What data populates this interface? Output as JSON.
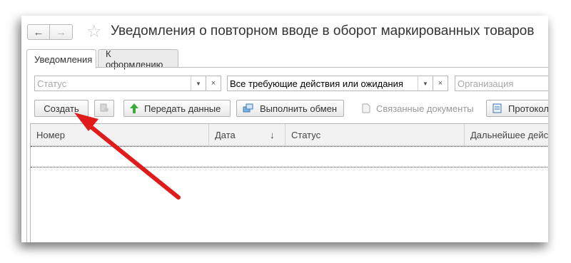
{
  "window": {
    "title": "Уведомления о повторном вводе в оборот маркированных товаров",
    "back_icon": "←",
    "forward_icon": "→",
    "star_icon": "☆"
  },
  "tabs": [
    {
      "label": "Уведомления",
      "active": true
    },
    {
      "label": "К оформлению",
      "active": false
    }
  ],
  "filters": {
    "status": {
      "placeholder": "Статус",
      "value": ""
    },
    "action": {
      "value": "Все требующие действия или ожидания"
    },
    "organization": {
      "placeholder": "Организация",
      "value": ""
    },
    "dropdown_glyph": "▼",
    "clear_glyph": "×"
  },
  "toolbar": {
    "create_label": "Создать",
    "send_label": "Передать данные",
    "exchange_label": "Выполнить обмен",
    "related_label": "Связанные документы",
    "protocol_label": "Протокол"
  },
  "table": {
    "columns": [
      "Номер",
      "Дата",
      "Статус",
      "Дальнейшее действие"
    ],
    "sort_indicator": "↓",
    "rows": []
  },
  "colors": {
    "annotation_arrow": "#e01b1b",
    "send_icon": "#3bab3b"
  }
}
